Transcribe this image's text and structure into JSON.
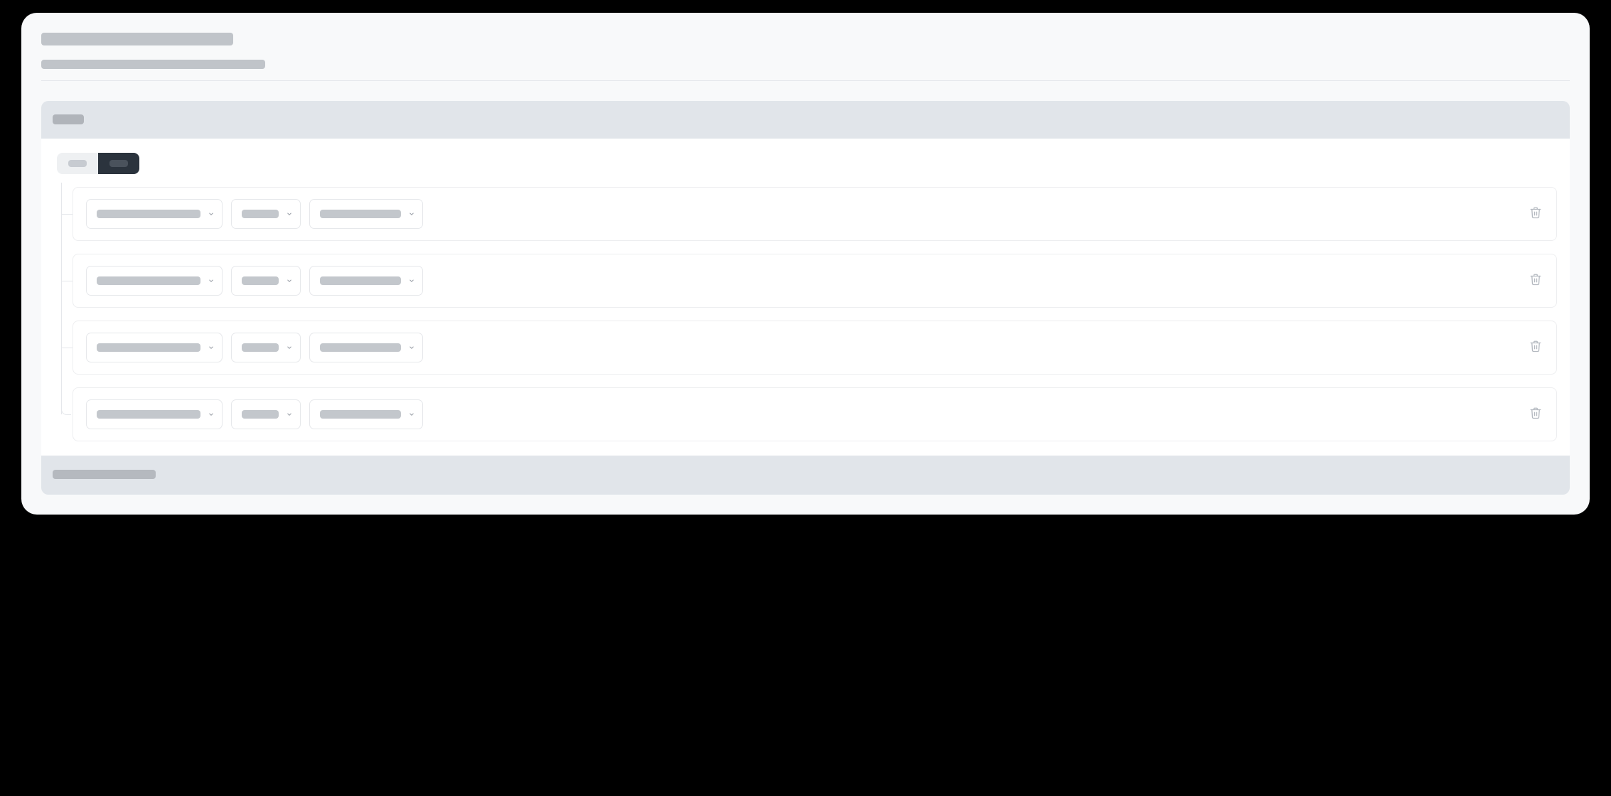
{
  "header": {
    "title": "",
    "subtitle": ""
  },
  "card": {
    "header_label": "",
    "footer_label": ""
  },
  "logic_toggle": {
    "options": [
      "",
      ""
    ],
    "active_index": 1
  },
  "rules": [
    {
      "field": "",
      "operator": "",
      "value": ""
    },
    {
      "field": "",
      "operator": "",
      "value": ""
    },
    {
      "field": "",
      "operator": "",
      "value": ""
    },
    {
      "field": "",
      "operator": "",
      "value": ""
    }
  ],
  "icons": {
    "chevron": "chevron-down-icon",
    "trash": "trash-icon"
  },
  "colors": {
    "page_bg": "#000000",
    "panel_bg": "#f8f9fa",
    "card_bg": "#e1e5ea",
    "skeleton": "#c0c4c9",
    "toggle_dark": "#2b333d"
  }
}
